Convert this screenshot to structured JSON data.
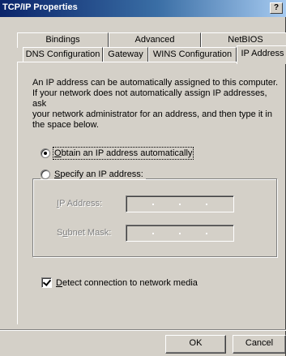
{
  "window": {
    "title": "TCP/IP Properties",
    "help_label": "?"
  },
  "tabs": {
    "row1": [
      "Bindings",
      "Advanced",
      "NetBIOS"
    ],
    "row2": [
      "DNS Configuration",
      "Gateway",
      "WINS Configuration",
      "IP Address"
    ],
    "active": "IP Address"
  },
  "description": "An IP address can be automatically assigned to this computer.\nIf your network does not automatically assign IP addresses, ask\nyour network administrator for an address, and then type it in\nthe space below.",
  "options": {
    "obtain": {
      "mnemonic": "O",
      "rest": "btain an IP address automatically",
      "selected": true
    },
    "specify": {
      "mnemonic": "S",
      "rest": "pecify an IP address:",
      "selected": false
    }
  },
  "fields": {
    "ip_address": {
      "mnemonic": "I",
      "rest": "P Address:",
      "value": ""
    },
    "subnet_mask": {
      "pre": "S",
      "mnemonic": "u",
      "rest": "bnet Mask:",
      "value": ""
    }
  },
  "detect": {
    "mnemonic": "D",
    "rest": "etect connection to network media",
    "checked": true
  },
  "buttons": {
    "ok": "OK",
    "cancel": "Cancel"
  }
}
